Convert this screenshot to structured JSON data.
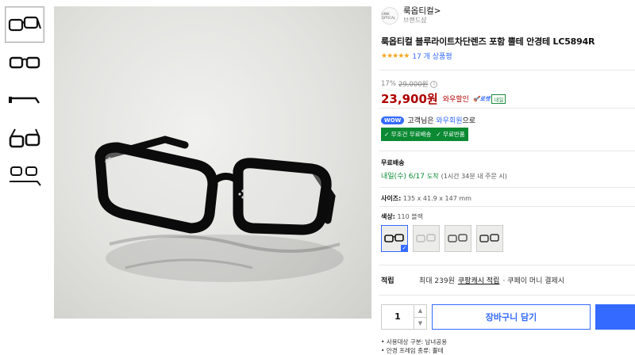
{
  "brand": {
    "logo_text": "UNIK OPTICAL",
    "name": "룩옵티컬>",
    "sub": "브랜드샵"
  },
  "product": {
    "title": "룩옵티컬 블루라이트차단렌즈 포함 뿔테 안경테 LC5894R",
    "stars": "★★★★★",
    "review_count": "17 개 상품평"
  },
  "price": {
    "discount": "17%",
    "original": "29,000원",
    "info_icon": "i",
    "sale": "23,900원",
    "wow_label": "와우할인",
    "rocket_label": "🚀로켓",
    "delivery_badge": "내일"
  },
  "wow": {
    "badge": "WOW",
    "text_prefix": "고객님은",
    "link": "와우회원",
    "text_suffix": "으로"
  },
  "free": {
    "item1": "✓ 무조건 무료배송",
    "item2": "✓ 무료반품"
  },
  "shipping": {
    "label": "무료배송",
    "date": "내일(수) 6/17",
    "suffix": "도착",
    "note": "(1시간 34분 내 주문 시)"
  },
  "size": {
    "label": "사이즈:",
    "value": "135 x 41.9 x 147 mm"
  },
  "color": {
    "label": "색상:",
    "value": "110 블랙",
    "selected_check": "✓"
  },
  "points": {
    "label": "적립",
    "text": "최대 239원",
    "cash": "쿠팡캐시 적립",
    "extra": "· 쿠페이 머니 결제시"
  },
  "quantity": {
    "value": "1",
    "up": "▲",
    "down": "▼"
  },
  "cart_button": "장바구니 담기",
  "bullets": [
    "사용대상 구분: 남녀공용",
    "안경 프레임 종류: 뿔테"
  ],
  "colors": {
    "accent": "#346aff",
    "price": "#ae0000",
    "green": "#0b8a33"
  }
}
